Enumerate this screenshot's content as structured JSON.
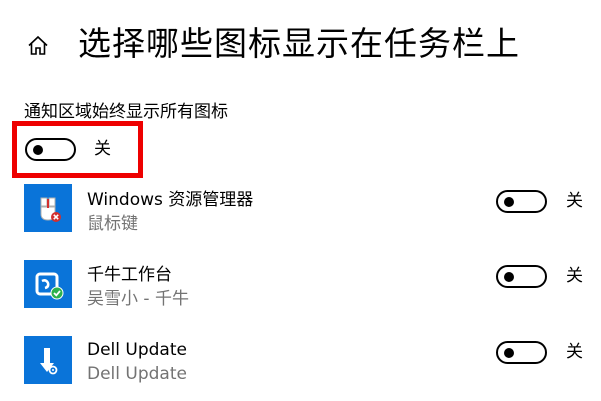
{
  "header": {
    "title": "选择哪些图标显示在任务栏上"
  },
  "always_show_all": {
    "label": "通知区域始终显示所有图标",
    "state_label": "关",
    "is_on": false
  },
  "apps": [
    {
      "name": "Windows 资源管理器",
      "subtitle": "鼠标键",
      "state_label": "关",
      "is_on": false,
      "icon": "mouse-keys-icon"
    },
    {
      "name": "千牛工作台",
      "subtitle": "吴雪小 - 千牛",
      "state_label": "关",
      "is_on": false,
      "icon": "qianniu-icon"
    },
    {
      "name": "Dell Update",
      "subtitle": "Dell Update",
      "state_label": "关",
      "is_on": false,
      "icon": "dell-update-icon"
    }
  ],
  "colors": {
    "app_icon_background": "#0a74d9",
    "highlight_border": "#ee0000",
    "subtitle_text": "#737373"
  }
}
